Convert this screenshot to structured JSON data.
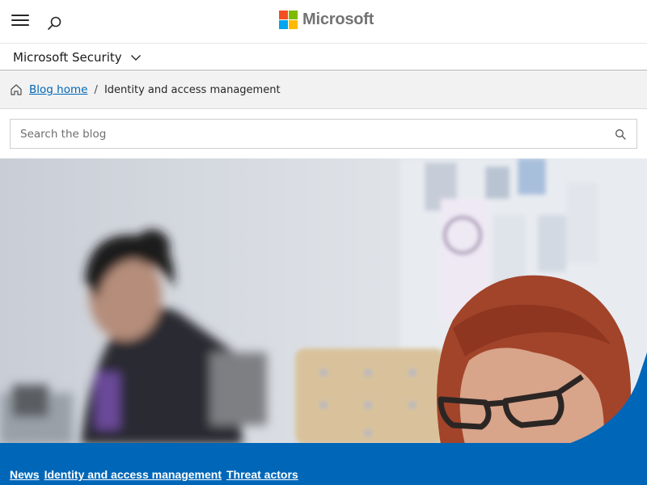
{
  "header": {
    "menu_icon": "hamburger-icon",
    "search_icon": "search-icon",
    "brand": "Microsoft",
    "logo_colors": [
      "#f25022",
      "#7fba00",
      "#00a4ef",
      "#ffb900"
    ]
  },
  "subnav": {
    "title": "Microsoft Security",
    "icon": "chevron-down-icon"
  },
  "breadcrumb": {
    "home_icon": "home-icon",
    "home_label": "Blog home",
    "separator": "/",
    "current": "Identity and access management"
  },
  "blog_search": {
    "placeholder": "Search the blog",
    "value": "",
    "icon": "search-icon"
  },
  "hero": {
    "image": "photo-two-women-working-office"
  },
  "tags": {
    "items": [
      "News",
      "Identity and access management",
      "Threat actors"
    ]
  },
  "colors": {
    "accent": "#0067b8",
    "breadcrumb_bg": "#f2f2f2",
    "text": "#1b1b1b"
  }
}
